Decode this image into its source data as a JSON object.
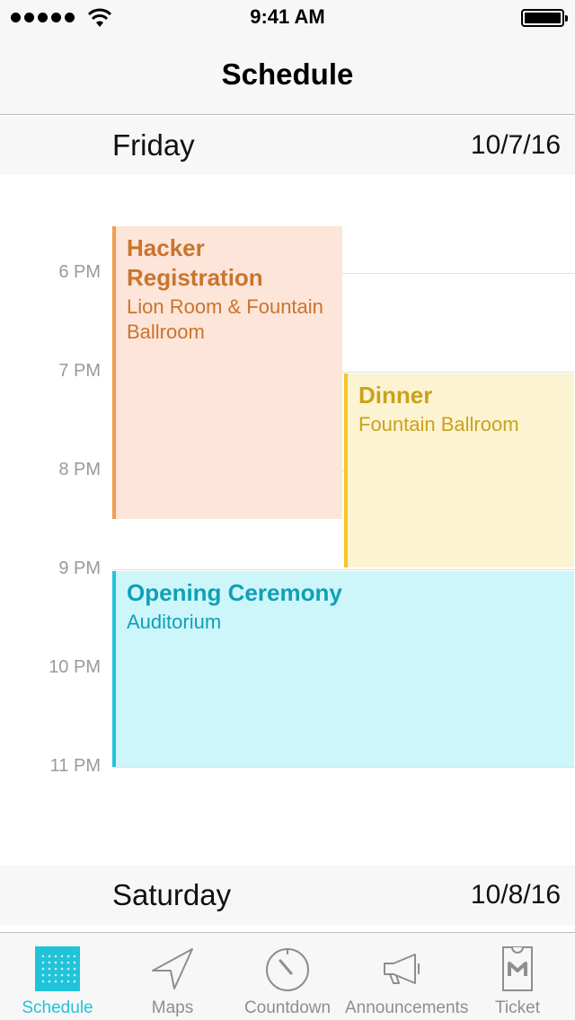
{
  "status_bar": {
    "time": "9:41 AM"
  },
  "nav": {
    "title": "Schedule"
  },
  "days": [
    {
      "name": "Friday",
      "date": "10/7/16"
    },
    {
      "name": "Saturday",
      "date": "10/8/16"
    }
  ],
  "hours": [
    "6 PM",
    "7 PM",
    "8 PM",
    "9 PM",
    "10 PM",
    "11 PM"
  ],
  "events": [
    {
      "title": "Hacker Registration",
      "location": "Lion Room & Fountain Ballroom",
      "color": "#f49b4e"
    },
    {
      "title": "Dinner",
      "location": "Fountain Ballroom",
      "color": "#f5c623"
    },
    {
      "title": "Opening Ceremony",
      "location": "Auditorium",
      "color": "#21c3d9"
    }
  ],
  "tabs": [
    {
      "label": "Schedule",
      "icon": "calendar-grid-icon",
      "active": true
    },
    {
      "label": "Maps",
      "icon": "location-arrow-icon"
    },
    {
      "label": "Countdown",
      "icon": "stopwatch-icon"
    },
    {
      "label": "Announcements",
      "icon": "megaphone-icon"
    },
    {
      "label": "Ticket",
      "icon": "ticket-icon"
    }
  ],
  "accent_color": "#21c3d9"
}
